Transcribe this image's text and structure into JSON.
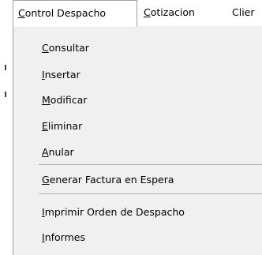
{
  "menubar": {
    "items": [
      {
        "mnemonic": "C",
        "rest": "ontrol Despacho"
      },
      {
        "mnemonic": "C",
        "rest": "otizacion"
      },
      {
        "mnemonic": "",
        "rest": "Clier"
      }
    ]
  },
  "dropdown": {
    "items": [
      {
        "mnemonic": "C",
        "rest": "onsultar"
      },
      {
        "mnemonic": "I",
        "rest": "nsertar"
      },
      {
        "mnemonic": "M",
        "rest": "odificar"
      },
      {
        "mnemonic": "E",
        "rest": "liminar"
      },
      {
        "mnemonic": "A",
        "rest": "nular"
      },
      {
        "mnemonic": "G",
        "rest": "enerar Factura en Espera"
      },
      {
        "mnemonic": "I",
        "rest": "mprimir Orden de Despacho"
      },
      {
        "mnemonic": "I",
        "rest": "nformes"
      }
    ]
  }
}
